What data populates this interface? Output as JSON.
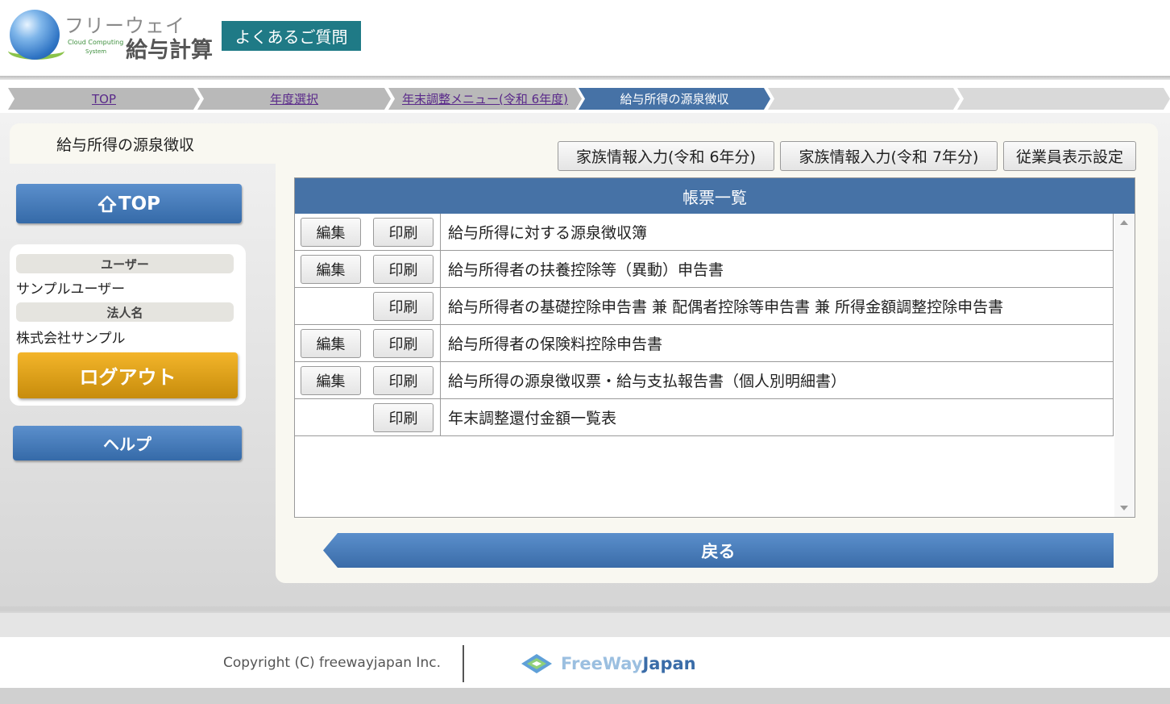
{
  "header": {
    "logo_top": "フリーウェイ",
    "logo_sub1": "Cloud Computing",
    "logo_sub2": "System",
    "logo_main": "給与計算",
    "faq_label": "よくあるご質問"
  },
  "breadcrumb": [
    {
      "label": "TOP"
    },
    {
      "label": "年度選択"
    },
    {
      "label": "年末調整メニュー(令和 6年度)"
    },
    {
      "label": "給与所得の源泉徴収"
    }
  ],
  "page_title": "給与所得の源泉徴収",
  "sidebar": {
    "top_label": "TOP",
    "user_heading": "ユーザー",
    "user_value": "サンプルユーザー",
    "corp_heading": "法人名",
    "corp_value": "株式会社サンプル",
    "logout_label": "ログアウト",
    "help_label": "ヘルプ"
  },
  "toolbar": {
    "family6_label": "家族情報入力(令和 6年分)",
    "family7_label": "家族情報入力(令和 7年分)",
    "employee_display_label": "従業員表示設定"
  },
  "list": {
    "heading": "帳票一覧",
    "edit_label": "編集",
    "print_label": "印刷",
    "rows": [
      {
        "label": "給与所得に対する源泉徴収簿",
        "has_edit": true
      },
      {
        "label": "給与所得者の扶養控除等（異動）申告書",
        "has_edit": true
      },
      {
        "label": "給与所得者の基礎控除申告書 兼 配偶者控除等申告書 兼 所得金額調整控除申告書",
        "has_edit": false
      },
      {
        "label": "給与所得者の保険料控除申告書",
        "has_edit": true
      },
      {
        "label": "給与所得の源泉徴収票・給与支払報告書（個人別明細書）",
        "has_edit": true
      },
      {
        "label": "年末調整還付金額一覧表",
        "has_edit": false
      }
    ]
  },
  "back_label": "戻る",
  "footer": {
    "copyright": "Copyright (C) freewayjapan Inc.",
    "brand_light": "FreeWay",
    "brand_dark": "Japan"
  },
  "colors": {
    "accent_blue": "#4672a6",
    "faq_teal": "#1f7a86",
    "logout_gold": "#e0a418"
  }
}
